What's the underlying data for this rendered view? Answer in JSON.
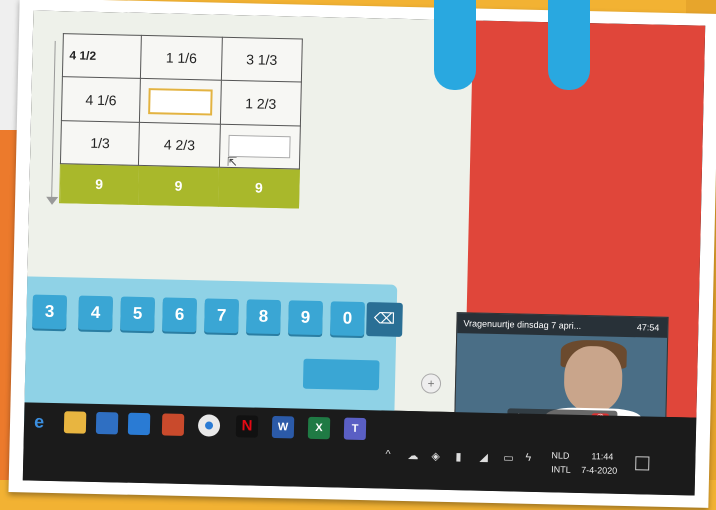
{
  "grid": {
    "rows": [
      [
        "4 1/2",
        "1 1/6",
        "3 1/3"
      ],
      [
        "4 1/6",
        "",
        "1 2/3"
      ],
      [
        "1/3",
        "4 2/3",
        ""
      ]
    ],
    "sums": [
      "9",
      "9",
      "9"
    ]
  },
  "keypad": {
    "keys": [
      "3",
      "4",
      "5",
      "6",
      "7",
      "8",
      "9",
      "0"
    ],
    "backspace": "⌫"
  },
  "video_call": {
    "title": "Vragenuurtje dinsdag 7 apri...",
    "time": "47:54"
  },
  "taskbar": {
    "language": "NLD",
    "layout": "INTL",
    "clock": "11:44",
    "date": "7-4-2020"
  },
  "colors": {
    "grid_sum": "#a9b82b",
    "keypad_bg": "#8fd2e6",
    "key": "#3aa6d4",
    "red_panel": "#e0463a"
  }
}
